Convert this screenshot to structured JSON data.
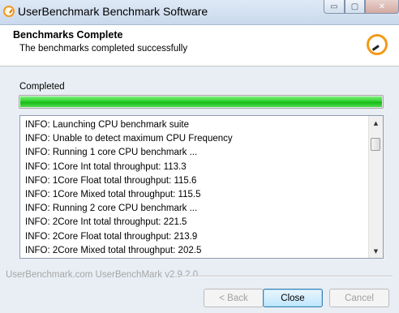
{
  "window": {
    "title": "UserBenchmark Benchmark Software",
    "controls": {
      "minimize": "▭",
      "maximize": "▢",
      "close": "✕"
    }
  },
  "header": {
    "title": "Benchmarks Complete",
    "subtitle": "The benchmarks completed successfully",
    "icon": "gauge-icon"
  },
  "status": {
    "label": "Completed",
    "progress_fraction": 1.0,
    "progress_color": "#2fd22f"
  },
  "log": {
    "lines": [
      "INFO: Launching CPU benchmark suite",
      "INFO: Unable to detect maximum CPU Frequency",
      "INFO: Running 1 core CPU benchmark ...",
      "INFO: 1Core Int total throughput: 113.3",
      "INFO: 1Core Float total throughput: 115.6",
      "INFO: 1Core Mixed total throughput: 115.5",
      "INFO: Running 2 core CPU benchmark ...",
      "INFO: 2Core Int total throughput: 221.5",
      "INFO: 2Core Float total throughput: 213.9",
      "INFO: 2Core Mixed total throughput: 202.5"
    ],
    "scroll_up": "▲",
    "scroll_down": "▼"
  },
  "footer": {
    "brand": "UserBenchmark.com UserBenchMark v2.9.2.0",
    "back_label": "< Back",
    "close_label": "Close",
    "cancel_label": "Cancel"
  }
}
